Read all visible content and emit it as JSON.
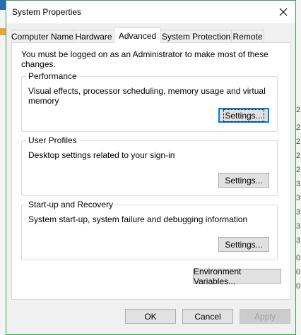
{
  "window": {
    "title": "System Properties"
  },
  "tabs": [
    {
      "label": "Computer Name",
      "active": false
    },
    {
      "label": "Hardware",
      "active": false
    },
    {
      "label": "Advanced",
      "active": true
    },
    {
      "label": "System Protection",
      "active": false
    },
    {
      "label": "Remote",
      "active": false
    }
  ],
  "notice": "You must be logged on as an Administrator to make most of these changes.",
  "performance": {
    "title": "Performance",
    "description": "Visual effects, processor scheduling, memory usage and virtual memory",
    "button": "Settings..."
  },
  "user_profiles": {
    "title": "User Profiles",
    "description": "Desktop settings related to your sign-in",
    "button": "Settings..."
  },
  "startup_recovery": {
    "title": "Start-up and Recovery",
    "description": "System start-up, system failure and debugging information",
    "button": "Settings..."
  },
  "env_button": "Environment Variables...",
  "footer": {
    "ok": "OK",
    "cancel": "Cancel",
    "apply": "Apply"
  },
  "background": {
    "right_chars": [
      "2",
      "2",
      "2",
      "2",
      "2",
      "3",
      "3",
      "3",
      "3",
      "3",
      "0",
      "0",
      "0"
    ]
  },
  "colors": {
    "window_border": "#2fa84f",
    "focus_border": "#0078d7",
    "dialog_bg": "#f0f0f0"
  }
}
